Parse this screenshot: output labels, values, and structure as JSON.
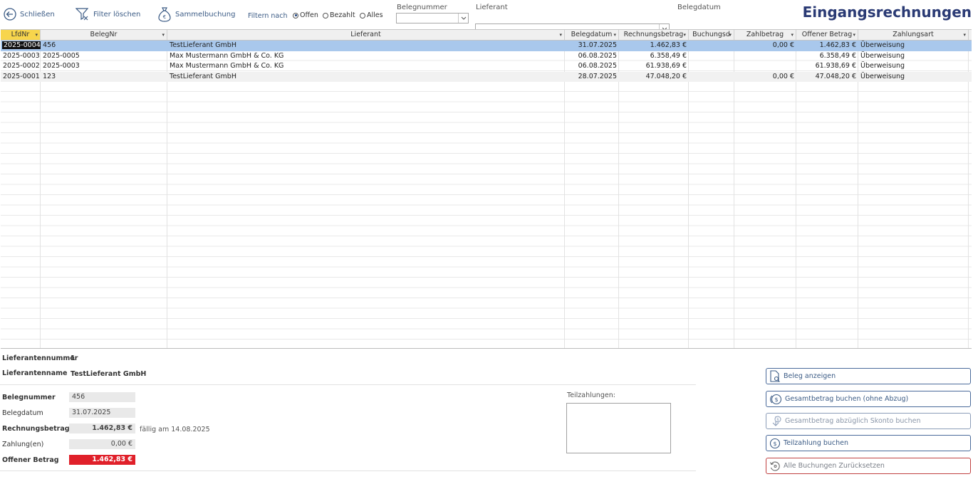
{
  "toolbar": {
    "close_label": "Schließen",
    "clear_filter_label": "Filter löschen",
    "batch_label": "Sammelbuchung",
    "filter_by_label": "Filtern nach",
    "radio_open": "Offen",
    "radio_paid": "Bezahlt",
    "radio_all": "Alles",
    "selected_filter": "Offen"
  },
  "filters": {
    "belegnummer_label": "Belegnummer",
    "lieferant_label": "Lieferant",
    "belegdatum_label": "Belegdatum"
  },
  "app_title": "Eingangsrechnungen",
  "grid": {
    "columns": [
      "LfdNr",
      "BelegNr",
      "Lieferant",
      "Belegdatum",
      "Rechnungsbetrag",
      "Buchungsd",
      "Zahlbetrag",
      "Offener Betrag",
      "Zahlungsart"
    ],
    "rows": [
      [
        "2025-0004",
        "456",
        "TestLieferant GmbH",
        "31.07.2025",
        "1.462,83 €",
        "",
        "0,00 €",
        "1.462,83 €",
        "Überweisung"
      ],
      [
        "2025-0003",
        "2025-0005",
        "Max Mustermann GmbH & Co. KG",
        "06.08.2025",
        "6.358,49 €",
        "",
        "",
        "6.358,49 €",
        "Überweisung"
      ],
      [
        "2025-0002",
        "2025-0003",
        "Max Mustermann GmbH & Co. KG",
        "06.08.2025",
        "61.938,69 €",
        "",
        "",
        "61.938,69 €",
        "Überweisung"
      ],
      [
        "2025-0001",
        "123",
        "TestLieferant GmbH",
        "28.07.2025",
        "47.048,20 €",
        "",
        "0,00 €",
        "47.048,20 €",
        "Überweisung"
      ]
    ]
  },
  "details": {
    "supplier_no_label": "Lieferantennummer",
    "supplier_no": "1",
    "supplier_name_label": "Lieferantenname",
    "supplier_name": "TestLieferant GmbH",
    "beleg_no_label": "Belegnummer",
    "beleg_no": "456",
    "beleg_date_label": "Belegdatum",
    "beleg_date": "31.07.2025",
    "invoice_amount_label": "Rechnungsbetrag",
    "invoice_amount": "1.462,83 €",
    "due_text": "fällig am 14.08.2025",
    "payments_label": "Zahlung(en)",
    "payments": "0,00 €",
    "open_amount_label": "Offener Betrag",
    "open_amount": "1.462,83 €",
    "partial_payments_label": "Teilzahlungen:"
  },
  "actions": {
    "show_doc": "Beleg anzeigen",
    "book_total": "Gesamtbetrag buchen (ohne Abzug)",
    "book_skonto": "Gesamtbetrag abzüglich Skonto buchen",
    "book_partial": "Teilzahlung buchen",
    "reset_all": "Alle Buchungen Zurücksetzen"
  },
  "colors": {
    "accent": "#3b5b85",
    "title": "#2a3a74",
    "selected_row": "#a9c8ec",
    "open_amount_bg": "#e0202a",
    "active_header": "#f7d54c"
  }
}
